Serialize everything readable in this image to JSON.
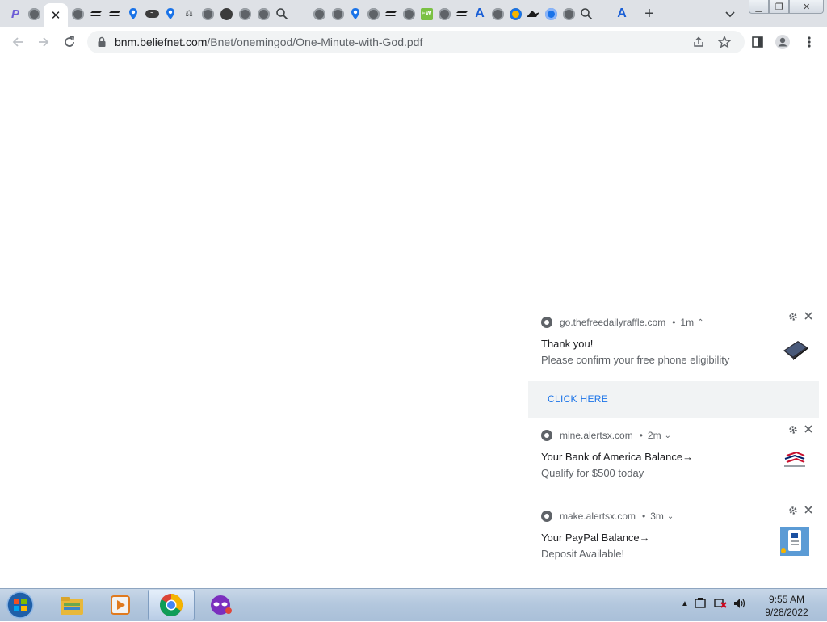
{
  "browser": {
    "tabs": [
      {
        "icon": "purple-p-icon"
      },
      {
        "icon": "globe-icon"
      },
      {
        "icon": "close-icon",
        "active": true
      },
      {
        "icon": "globe-icon"
      },
      {
        "icon": "dash-logo-icon"
      },
      {
        "icon": "dash-logo-icon"
      },
      {
        "icon": "map-pin-icon"
      },
      {
        "icon": "oval-badge-icon"
      },
      {
        "icon": "map-pin-icon"
      },
      {
        "icon": "scale-icon"
      },
      {
        "icon": "globe-icon"
      },
      {
        "icon": "dark-globe-icon"
      },
      {
        "icon": "globe-icon"
      },
      {
        "icon": "globe-icon"
      },
      {
        "icon": "magnifier-icon"
      },
      {
        "icon": "globe-icon"
      },
      {
        "icon": "globe-icon"
      },
      {
        "icon": "map-pin-icon"
      },
      {
        "icon": "globe-icon"
      },
      {
        "icon": "dash-logo-icon"
      },
      {
        "icon": "globe-icon"
      },
      {
        "icon": "ew-badge-icon"
      },
      {
        "icon": "globe-icon"
      },
      {
        "icon": "dash-logo-icon"
      },
      {
        "icon": "letter-a-icon"
      },
      {
        "icon": "globe-icon"
      },
      {
        "icon": "ie-icon"
      },
      {
        "icon": "hat-icon"
      },
      {
        "icon": "blue-ring-icon"
      },
      {
        "icon": "globe-icon"
      },
      {
        "icon": "magnifier-icon"
      },
      {
        "icon": "letter-a-icon"
      }
    ],
    "address_host": "bnm.beliefnet.com",
    "address_path": "/Bnet/onemingod/One-Minute-with-God.pdf"
  },
  "notifications": [
    {
      "source": "go.thefreedailyraffle.com",
      "age": "1m",
      "expanded": true,
      "title": "Thank you!",
      "body": "Please confirm your free phone eligibility",
      "action": "CLICK HERE",
      "image": "phone-image"
    },
    {
      "source": "mine.alertsx.com",
      "age": "2m",
      "expanded": false,
      "title": " Your Bank of America Balance→",
      "body": "Qualify for $500 today",
      "image": "bank-of-america-logo"
    },
    {
      "source": "make.alertsx.com",
      "age": "3m",
      "expanded": false,
      "title": " Your PayPal Balance→",
      "body": "Deposit Available!",
      "image": "paypal-app-image"
    }
  ],
  "taskbar": {
    "items": [
      "windows-explorer-icon",
      "media-player-icon",
      "chrome-icon",
      "mask-app-icon"
    ],
    "active": "chrome-icon"
  },
  "clock": {
    "time": "9:55 AM",
    "date": "9/28/2022"
  },
  "colors": {
    "tabstrip": "#dee1e6",
    "accent": "#1a73e8",
    "taskbar": "#b4c8de"
  }
}
